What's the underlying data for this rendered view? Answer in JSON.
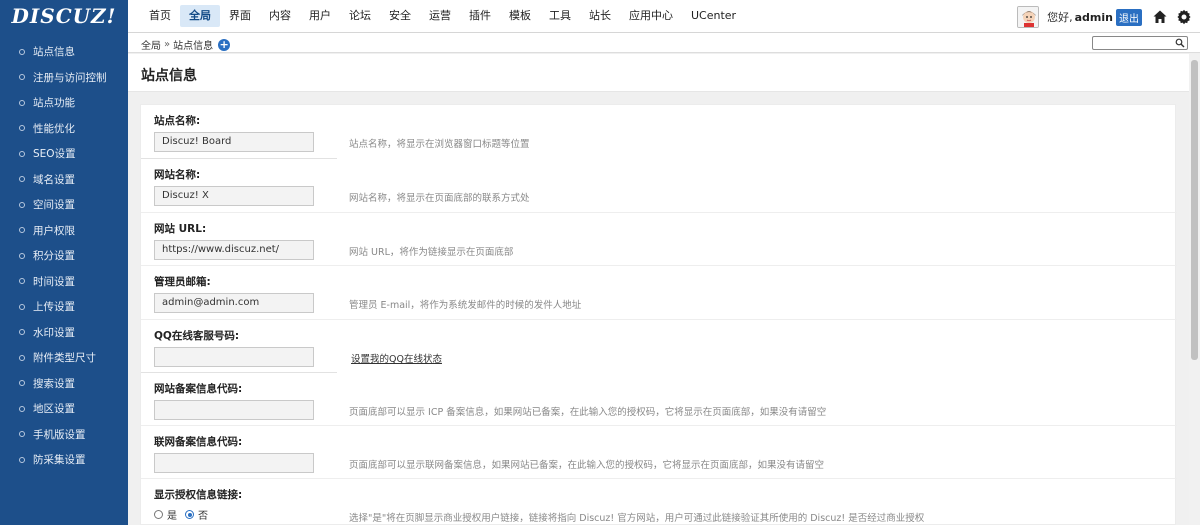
{
  "logo": "DISCUZ!",
  "nav": [
    "首页",
    "全局",
    "界面",
    "内容",
    "用户",
    "论坛",
    "安全",
    "运营",
    "插件",
    "模板",
    "工具",
    "站长",
    "应用中心",
    "UCenter"
  ],
  "nav_active_index": 1,
  "user": {
    "greeting": "您好,",
    "name": "admin",
    "logout": "退出"
  },
  "sidebar": [
    "站点信息",
    "注册与访问控制",
    "站点功能",
    "性能优化",
    "SEO设置",
    "域名设置",
    "空间设置",
    "用户权限",
    "积分设置",
    "时间设置",
    "上传设置",
    "水印设置",
    "附件类型尺寸",
    "搜索设置",
    "地区设置",
    "手机版设置",
    "防采集设置"
  ],
  "breadcrumb": {
    "root": "全局",
    "sep": "»",
    "current": "站点信息"
  },
  "search": {
    "placeholder": ""
  },
  "page_title": "站点信息",
  "form": {
    "site_name": {
      "label": "站点名称:",
      "value": "Discuz! Board",
      "desc": "站点名称，将显示在浏览器窗口标题等位置"
    },
    "web_name": {
      "label": "网站名称:",
      "value": "Discuz! X",
      "desc": "网站名称，将显示在页面底部的联系方式处"
    },
    "site_url": {
      "label": "网站 URL:",
      "value": "https://www.discuz.net/",
      "desc": "网站 URL，将作为链接显示在页面底部"
    },
    "admin_email": {
      "label": "管理员邮箱:",
      "value": "admin@admin.com",
      "desc": "管理员 E-mail，将作为系统发邮件的时候的发件人地址"
    },
    "qq": {
      "label": "QQ在线客服号码:",
      "value": "",
      "link": "设置我的QQ在线状态"
    },
    "icp": {
      "label": "网站备案信息代码:",
      "value": "",
      "desc": "页面底部可以显示 ICP 备案信息，如果网站已备案，在此输入您的授权码，它将显示在页面底部，如果没有请留空"
    },
    "mps": {
      "label": "联网备案信息代码:",
      "value": "",
      "desc": "页面底部可以显示联网备案信息，如果网站已备案，在此输入您的授权码，它将显示在页面底部，如果没有请留空"
    },
    "license_link": {
      "label": "显示授权信息链接:",
      "yes": "是",
      "no": "否",
      "selected": "否",
      "desc": "选择\"是\"将在页脚显示商业授权用户链接，链接将指向 Discuz! 官方网站，用户可通过此链接验证其所使用的 Discuz! 是否经过商业授权"
    }
  },
  "colors": {
    "brand": "#1d4f8a",
    "accent": "#2a6fc2",
    "active_nav_bg": "#d9e8f7"
  }
}
